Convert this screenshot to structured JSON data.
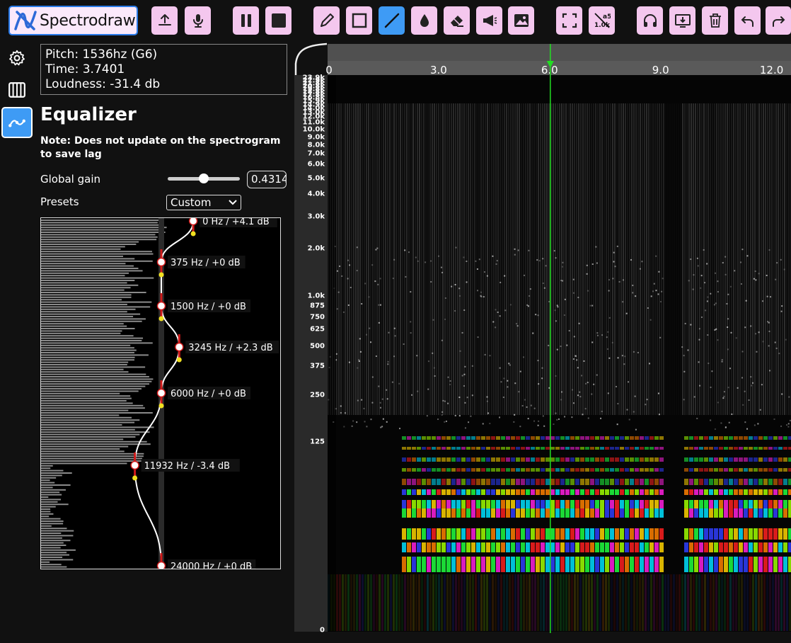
{
  "app": {
    "name": "Spectrodraw",
    "accent": "#3e9bf5",
    "button_bg": "#f4c7ee"
  },
  "toolbar": {
    "buttons": [
      {
        "id": "upload",
        "icon": "upload-icon"
      },
      {
        "id": "record",
        "icon": "microphone-icon"
      },
      {
        "id": "pause",
        "icon": "pause-icon"
      },
      {
        "id": "stop",
        "icon": "stop-icon"
      },
      {
        "id": "pencil",
        "icon": "pencil-icon"
      },
      {
        "id": "rectangle",
        "icon": "rectangle-icon"
      },
      {
        "id": "line",
        "icon": "line-icon",
        "active": true
      },
      {
        "id": "fill",
        "icon": "drop-icon"
      },
      {
        "id": "eraser",
        "icon": "eraser-icon"
      },
      {
        "id": "amplify",
        "icon": "megaphone-icon"
      },
      {
        "id": "image",
        "icon": "image-icon"
      },
      {
        "id": "fullscreen",
        "icon": "fullscreen-icon"
      },
      {
        "id": "note-toggle",
        "icon": "note-scale-icon",
        "top_text": "a5",
        "bottom_text": "1.0k"
      },
      {
        "id": "listen",
        "icon": "headphones-icon"
      },
      {
        "id": "export",
        "icon": "download-icon"
      },
      {
        "id": "delete",
        "icon": "trash-icon"
      },
      {
        "id": "undo",
        "icon": "undo-icon"
      },
      {
        "id": "redo",
        "icon": "redo-icon"
      }
    ]
  },
  "sidebar": {
    "items": [
      {
        "id": "settings",
        "icon": "gear-icon"
      },
      {
        "id": "piano",
        "icon": "piano-icon"
      },
      {
        "id": "equalizer",
        "icon": "equalizer-curve-icon",
        "active": true
      }
    ]
  },
  "info": {
    "pitch": "Pitch: 1536hz (G6)",
    "time": "Time: 3.7401",
    "loudness": "Loudness: -31.4 db"
  },
  "equalizer": {
    "title": "Equalizer",
    "note": "Note: Does not update on the spectrogram to save lag",
    "global_gain_label": "Global gain",
    "global_gain_value": "0.4314",
    "global_gain_fraction": 0.5,
    "presets_label": "Presets",
    "preset_selected": "Custom",
    "points": [
      {
        "label": "0 Hz / +4.1 dB",
        "freq": 0,
        "gain": 4.1
      },
      {
        "label": "375 Hz / +0 dB",
        "freq": 375,
        "gain": 0
      },
      {
        "label": "1500 Hz / +0 dB",
        "freq": 1500,
        "gain": 0
      },
      {
        "label": "3245 Hz / +2.3 dB",
        "freq": 3245,
        "gain": 2.3
      },
      {
        "label": "6000 Hz / +0 dB",
        "freq": 6000,
        "gain": 0
      },
      {
        "label": "11932 Hz / -3.4 dB",
        "freq": 11932,
        "gain": -3.4
      },
      {
        "label": "24000 Hz / +0 dB",
        "freq": 24000,
        "gain": 0
      }
    ]
  },
  "timeline": {
    "ticks": [
      "0",
      "3.0",
      "6.0",
      "9.0",
      "12.0"
    ],
    "tick_values": [
      0,
      3,
      6,
      9,
      12
    ],
    "playhead_time": 6.0,
    "playhead_color": "#22dd22"
  },
  "freq_axis": {
    "labels": [
      "23.9k",
      "22.9k",
      "21.8k",
      "20.8k",
      "19.8k",
      "18.8k",
      "17.8k",
      "16.8k",
      "15.9k",
      "14.9k",
      "14.0k",
      "13.0k",
      "12.0k",
      "11.0k",
      "10.0k",
      "9.0k",
      "8.0k",
      "7.0k",
      "6.0k",
      "5.0k",
      "4.0k",
      "3.0k",
      "2.0k",
      "1.0k",
      "875",
      "750",
      "625",
      "500",
      "375",
      "250",
      "125",
      "0"
    ]
  }
}
